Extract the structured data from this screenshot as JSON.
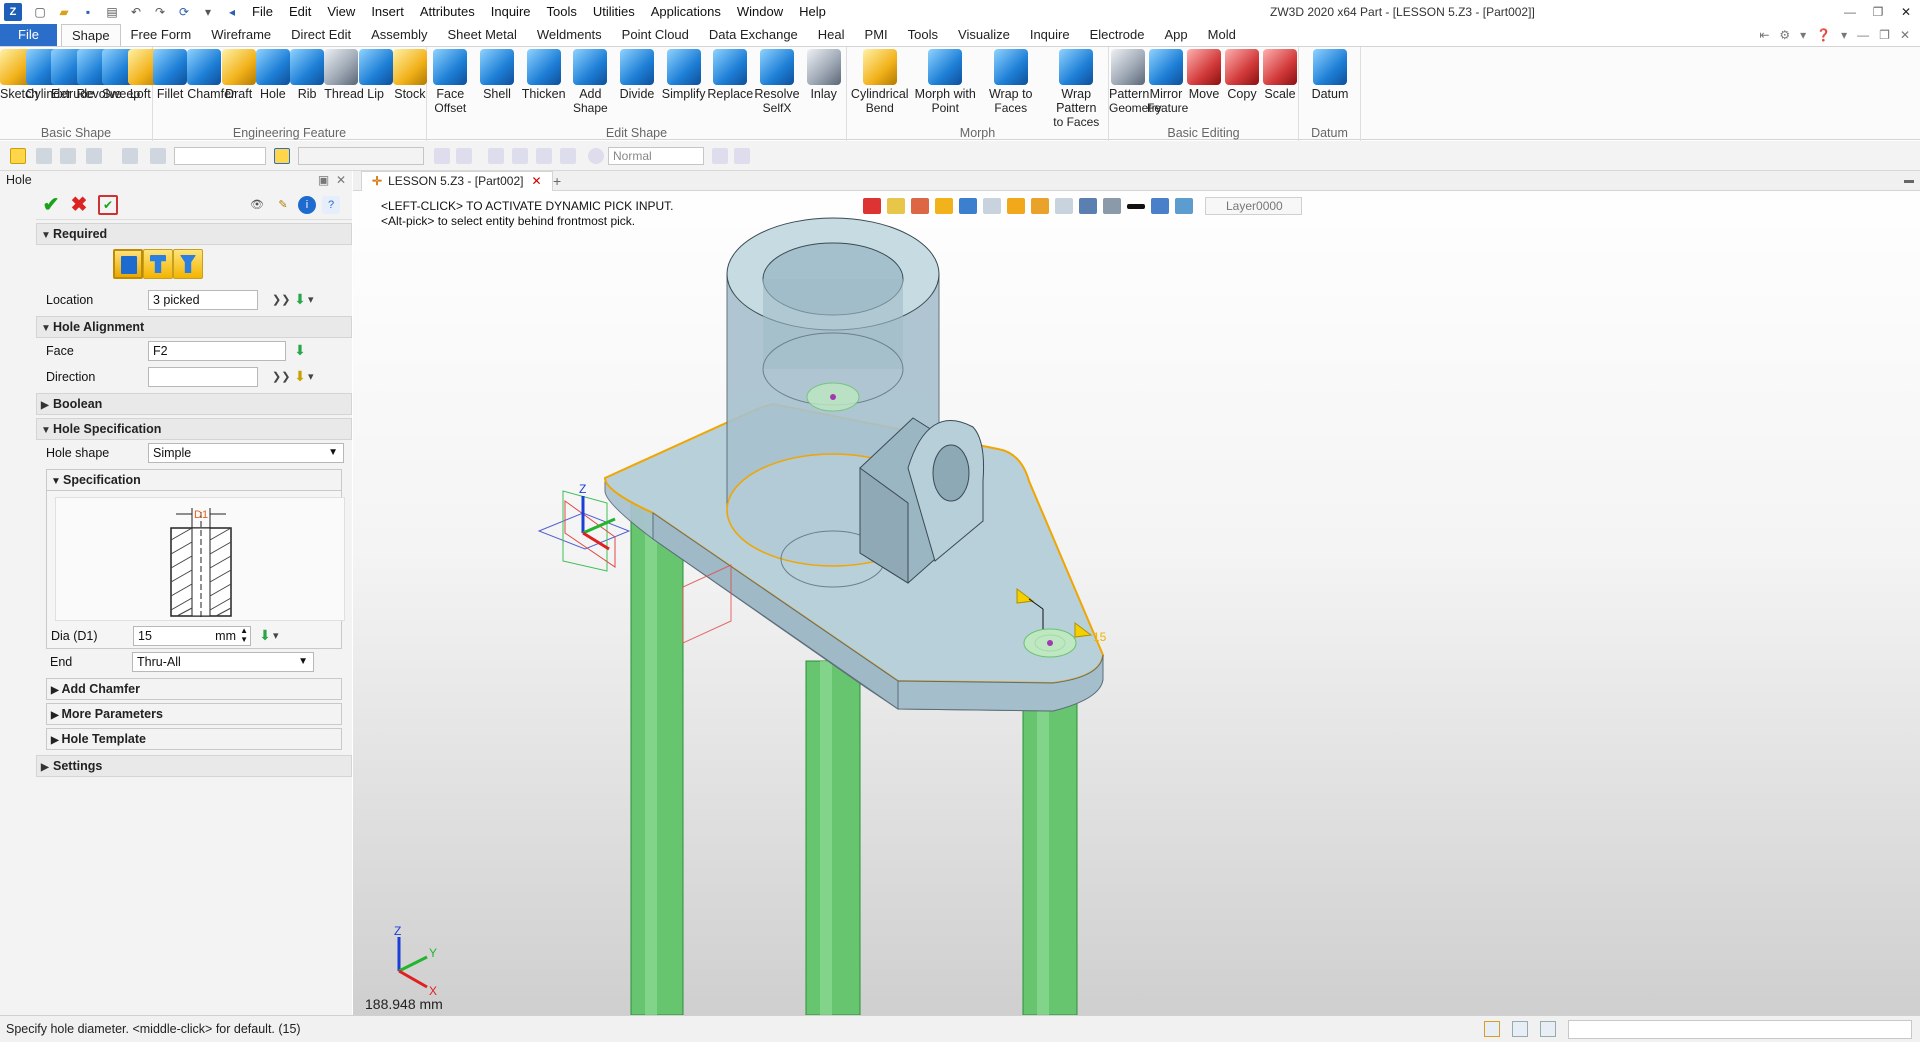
{
  "titlebar": {
    "menus": [
      "File",
      "Edit",
      "View",
      "Insert",
      "Attributes",
      "Inquire",
      "Tools",
      "Utilities",
      "Applications",
      "Window",
      "Help"
    ],
    "title": "ZW3D 2020 x64      Part - [LESSON 5.Z3 - [Part002]]"
  },
  "ribbon_tabs": [
    "File",
    "Shape",
    "Free Form",
    "Wireframe",
    "Direct Edit",
    "Assembly",
    "Sheet Metal",
    "Weldments",
    "Point Cloud",
    "Data Exchange",
    "Heal",
    "PMI",
    "Tools",
    "Visualize",
    "Inquire",
    "Electrode",
    "App",
    "Mold"
  ],
  "ribbon_groups": [
    {
      "label": "Basic Shape",
      "buttons": [
        {
          "label": "Sketch",
          "sub": "",
          "icon": "sketch-icon",
          "color": "yellow"
        },
        {
          "label": "Cylinder",
          "sub": "",
          "icon": "cylinder-icon",
          "color": "blue"
        },
        {
          "label": "Extrude",
          "sub": "",
          "icon": "extrude-icon",
          "color": "blue"
        },
        {
          "label": "Revolve",
          "sub": "",
          "icon": "revolve-icon",
          "color": "blue"
        },
        {
          "label": "Sweep",
          "sub": "",
          "icon": "sweep-icon",
          "color": "blue"
        },
        {
          "label": "Loft",
          "sub": "",
          "icon": "loft-icon",
          "color": "yellow"
        }
      ]
    },
    {
      "label": "Engineering Feature",
      "buttons": [
        {
          "label": "Fillet",
          "sub": "",
          "icon": "fillet-icon",
          "color": "blue"
        },
        {
          "label": "Chamfer",
          "sub": "",
          "icon": "chamfer-icon",
          "color": "blue"
        },
        {
          "label": "Draft",
          "sub": "",
          "icon": "draft-icon",
          "color": "yellow"
        },
        {
          "label": "Hole",
          "sub": "",
          "icon": "hole-icon",
          "color": "blue"
        },
        {
          "label": "Rib",
          "sub": "",
          "icon": "rib-icon",
          "color": "blue"
        },
        {
          "label": "Thread",
          "sub": "",
          "icon": "thread-icon",
          "color": "grey"
        },
        {
          "label": "Lip",
          "sub": "",
          "icon": "lip-icon",
          "color": "blue"
        },
        {
          "label": "Stock",
          "sub": "",
          "icon": "stock-icon",
          "color": "yellow"
        }
      ]
    },
    {
      "label": "Edit Shape",
      "buttons": [
        {
          "label": "Face",
          "sub": "Offset",
          "icon": "face-offset-icon",
          "color": "blue"
        },
        {
          "label": "Shell",
          "sub": "",
          "icon": "shell-icon",
          "color": "blue"
        },
        {
          "label": "Thicken",
          "sub": "",
          "icon": "thicken-icon",
          "color": "blue"
        },
        {
          "label": "Add",
          "sub": "Shape",
          "icon": "add-shape-icon",
          "color": "blue"
        },
        {
          "label": "Divide",
          "sub": "",
          "icon": "divide-icon",
          "color": "blue"
        },
        {
          "label": "Simplify",
          "sub": "",
          "icon": "simplify-icon",
          "color": "blue"
        },
        {
          "label": "Replace",
          "sub": "",
          "icon": "replace-icon",
          "color": "blue"
        },
        {
          "label": "Resolve",
          "sub": "SelfX",
          "icon": "resolve-selfx-icon",
          "color": "blue"
        },
        {
          "label": "Inlay",
          "sub": "",
          "icon": "inlay-icon",
          "color": "grey"
        }
      ]
    },
    {
      "label": "Morph",
      "buttons": [
        {
          "label": "Cylindrical",
          "sub": "Bend",
          "icon": "cylindrical-bend-icon",
          "color": "yellow"
        },
        {
          "label": "Morph with",
          "sub": "Point",
          "icon": "morph-point-icon",
          "color": "blue"
        },
        {
          "label": "Wrap to",
          "sub": "Faces",
          "icon": "wrap-faces-icon",
          "color": "blue"
        },
        {
          "label": "Wrap Pattern",
          "sub": "to Faces",
          "icon": "wrap-pattern-icon",
          "color": "blue"
        }
      ]
    },
    {
      "label": "Basic Editing",
      "buttons": [
        {
          "label": "Pattern",
          "sub": "Geometry",
          "icon": "pattern-geometry-icon",
          "color": "grey"
        },
        {
          "label": "Mirror",
          "sub": "Feature",
          "icon": "mirror-feature-icon",
          "color": "blue"
        },
        {
          "label": "Move",
          "sub": "",
          "icon": "move-icon",
          "color": "red"
        },
        {
          "label": "Copy",
          "sub": "",
          "icon": "copy-icon",
          "color": "red"
        },
        {
          "label": "Scale",
          "sub": "",
          "icon": "scale-icon",
          "color": "red"
        }
      ]
    },
    {
      "label": "Datum",
      "buttons": [
        {
          "label": "Datum",
          "sub": "",
          "icon": "datum-icon",
          "color": "blue"
        }
      ]
    }
  ],
  "context_bar": {
    "render_mode": "Normal"
  },
  "panel": {
    "title": "Hole",
    "required": {
      "header": "Required",
      "location_label": "Location",
      "location_value": "3 picked"
    },
    "alignment": {
      "header": "Hole Alignment",
      "face_label": "Face",
      "face_value": "F2",
      "direction_label": "Direction",
      "direction_value": ""
    },
    "boolean_header": "Boolean",
    "specification": {
      "header": "Hole Specification",
      "shape_label": "Hole shape",
      "shape_value": "Simple",
      "sub_header": "Specification",
      "diagram_label": "D1",
      "dia_label": "Dia (D1)",
      "dia_value": "15",
      "dia_unit": "mm",
      "end_label": "End",
      "end_value": "Thru-All"
    },
    "collapsed": [
      "Add Chamfer",
      "More Parameters",
      "Hole Template"
    ],
    "settings_header": "Settings"
  },
  "viewport": {
    "tab_label": "LESSON 5.Z3 - [Part002]",
    "prompt1": "<LEFT-CLICK> TO ACTIVATE DYNAMIC PICK INPUT.",
    "prompt2": "<Alt-pick> to select entity behind frontmost pick.",
    "layer": "Layer0000",
    "distance": "188.948 mm",
    "dim_label": "15",
    "axis": {
      "x": "X",
      "y": "Y",
      "z": "Z"
    }
  },
  "colors": {
    "accent": "#2b6ec9",
    "pin_green": "#67c46f",
    "part_fill": "#a9c6d2",
    "highlight": "#f0a500"
  },
  "status": {
    "text": "Specify hole diameter.   <middle-click> for default. (15)"
  }
}
